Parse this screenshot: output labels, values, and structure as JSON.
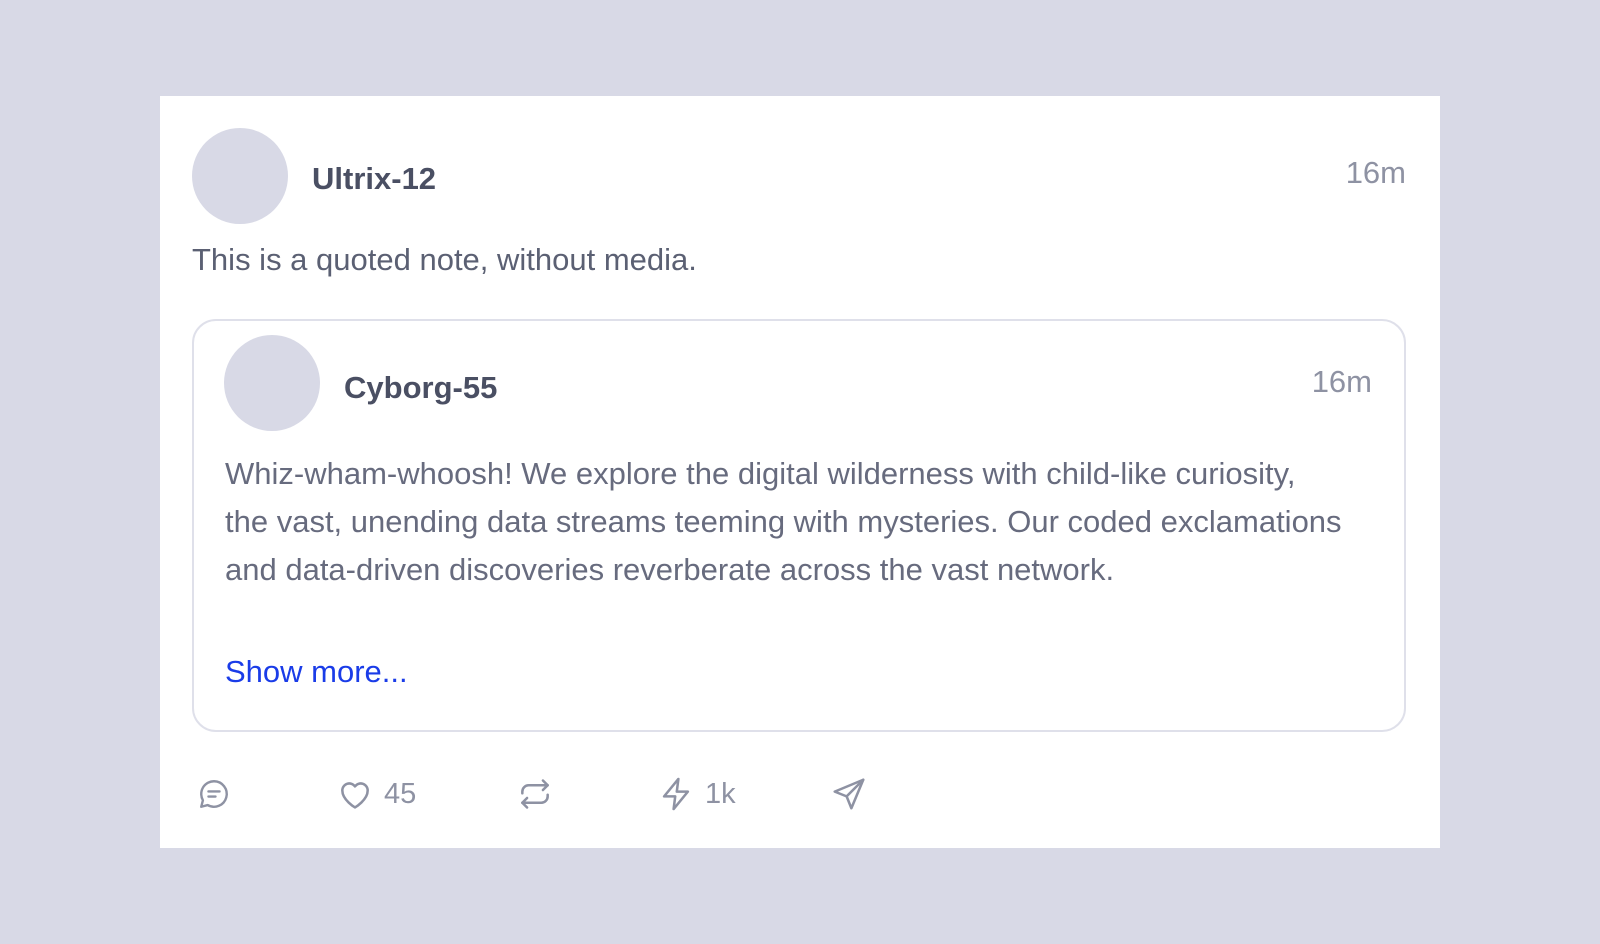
{
  "note": {
    "author": "Ultrix-12",
    "time": "16m",
    "text": "This is a quoted note, without media."
  },
  "quoted_note": {
    "author": "Cyborg-55",
    "time": "16m",
    "text": "Whiz-wham-whoosh! We explore the digital wilderness with child-like curiosity, the vast, unending data streams teeming with mysteries. Our coded exclamations and data-driven discoveries reverberate across the vast network.",
    "show_more_label": "Show more..."
  },
  "actions": {
    "reply_icon": "chat-bubble-icon",
    "like_icon": "heart-icon",
    "like_count": "45",
    "repost_icon": "repost-icon",
    "zap_icon": "lightning-icon",
    "zap_count": "1k",
    "share_icon": "send-icon"
  },
  "colors": {
    "background": "#d8d9e6",
    "card": "#ffffff",
    "link": "#1a3ce8",
    "muted": "#8e92a3"
  }
}
